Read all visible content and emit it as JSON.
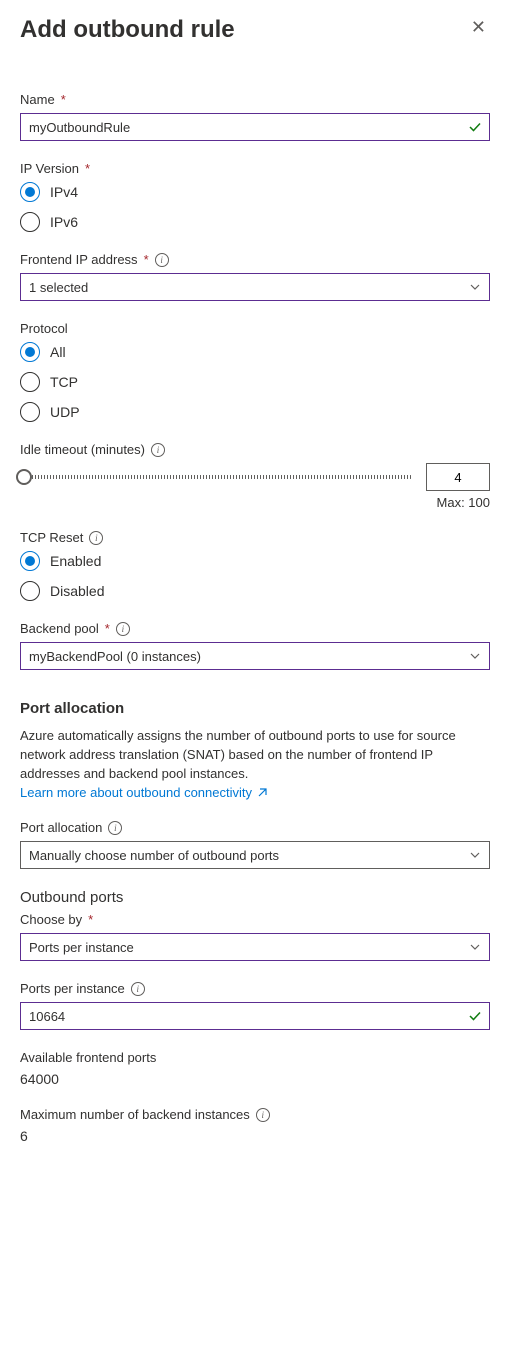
{
  "header": {
    "title": "Add outbound rule"
  },
  "name": {
    "label": "Name",
    "value": "myOutboundRule"
  },
  "ipVersion": {
    "label": "IP Version",
    "options": [
      {
        "label": "IPv4",
        "selected": true
      },
      {
        "label": "IPv6",
        "selected": false
      }
    ]
  },
  "frontendIp": {
    "label": "Frontend IP address",
    "value": "1 selected"
  },
  "protocol": {
    "label": "Protocol",
    "options": [
      {
        "label": "All",
        "selected": true
      },
      {
        "label": "TCP",
        "selected": false
      },
      {
        "label": "UDP",
        "selected": false
      }
    ]
  },
  "idleTimeout": {
    "label": "Idle timeout (minutes)",
    "value": "4",
    "maxLabel": "Max: 100"
  },
  "tcpReset": {
    "label": "TCP Reset",
    "options": [
      {
        "label": "Enabled",
        "selected": true
      },
      {
        "label": "Disabled",
        "selected": false
      }
    ]
  },
  "backendPool": {
    "label": "Backend pool",
    "value": "myBackendPool (0 instances)"
  },
  "portAllocation": {
    "sectionTitle": "Port allocation",
    "helperText": "Azure automatically assigns the number of outbound ports to use for source network address translation (SNAT) based on the number of frontend IP addresses and backend pool instances.",
    "learnMore": "Learn more about outbound connectivity",
    "label": "Port allocation",
    "value": "Manually choose number of outbound ports"
  },
  "outboundPorts": {
    "heading": "Outbound ports",
    "chooseBy": {
      "label": "Choose by",
      "value": "Ports per instance"
    },
    "portsPerInstance": {
      "label": "Ports per instance",
      "value": "10664"
    },
    "availablePorts": {
      "label": "Available frontend ports",
      "value": "64000"
    },
    "maxInstances": {
      "label": "Maximum number of backend instances",
      "value": "6"
    }
  }
}
